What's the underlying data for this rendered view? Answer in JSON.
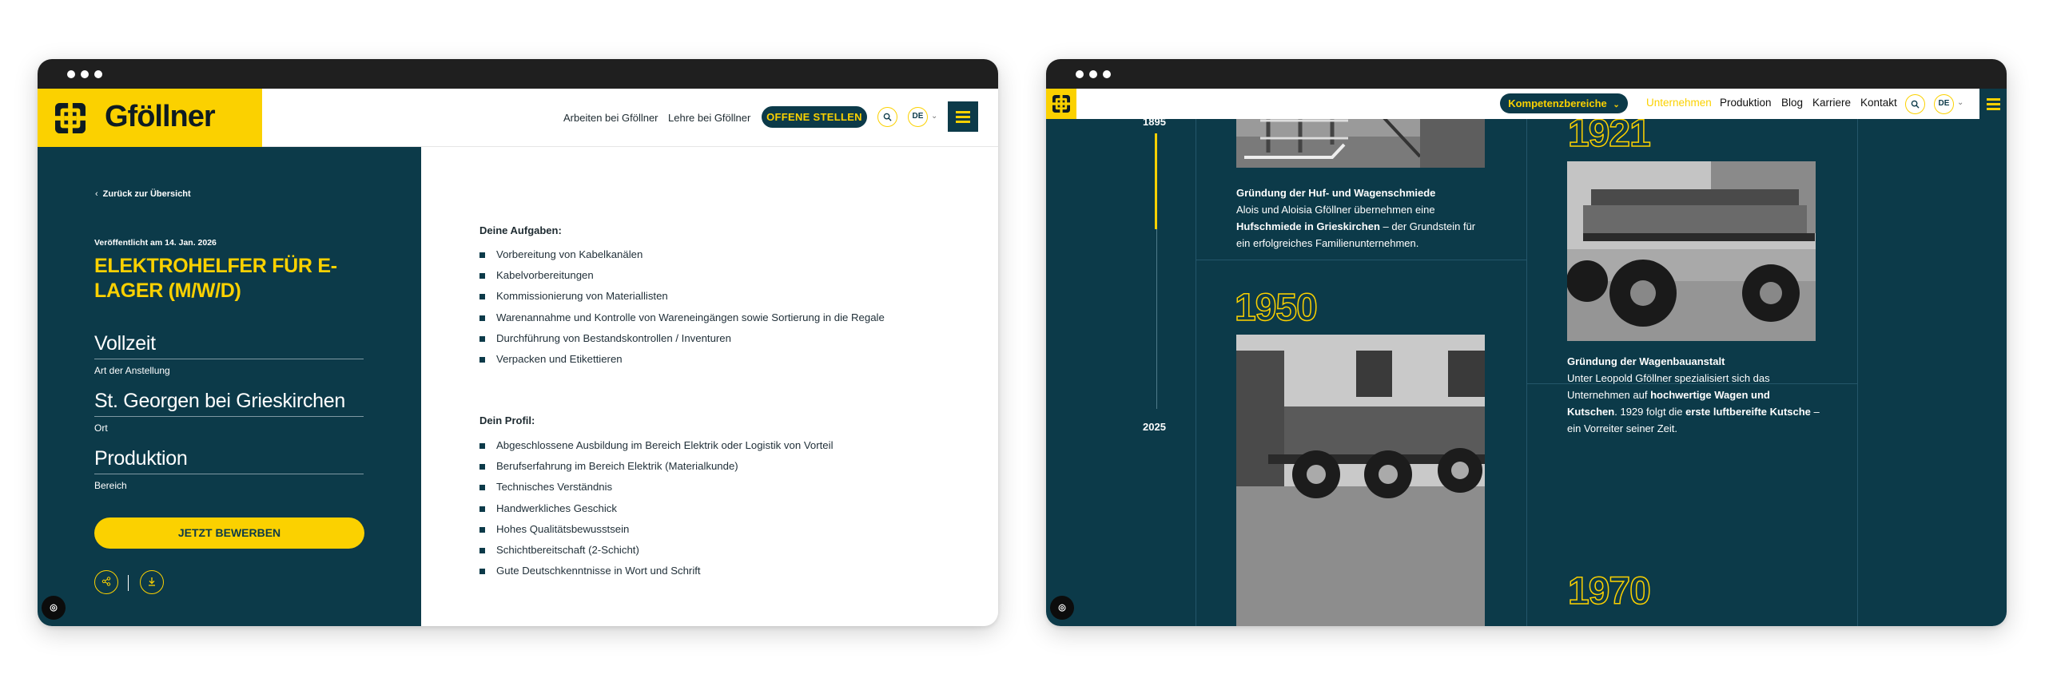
{
  "left_window": {
    "logo_text": "Gföllner",
    "nav": {
      "arbeiten": "Arbeiten bei Gföllner",
      "lehre": "Lehre bei Gföllner",
      "offene_stellen": "OFFENE STELLEN",
      "lang": "DE"
    },
    "sidebar": {
      "back_link": "Zurück zur Übersicht",
      "published": "Veröffentlicht am 14. Jan. 2026",
      "job_title": "ELEKTROHELFER FÜR E-LAGER (M/W/D)",
      "fields": [
        {
          "value": "Vollzeit",
          "label": "Art der Anstellung"
        },
        {
          "value": "St. Georgen bei Grieskirchen",
          "label": "Ort"
        },
        {
          "value": "Produktion",
          "label": "Bereich"
        }
      ],
      "apply_button": "JETZT BEWERBEN"
    },
    "main": {
      "tasks_heading": "Deine Aufgaben:",
      "tasks": [
        "Vorbereitung von Kabelkanälen",
        "Kabelvorbereitungen",
        "Kommissionierung von Materiallisten",
        "Warenannahme und Kontrolle von Wareneingängen sowie Sortierung in die Regale",
        "Durchführung von Bestandskontrollen / Inventuren",
        "Verpacken und Etikettieren"
      ],
      "profile_heading": "Dein Profil:",
      "profile": [
        "Abgeschlossene Ausbildung im Bereich Elektrik oder Logistik von Vorteil",
        "Berufserfahrung im Bereich Elektrik (Materialkunde)",
        "Technisches Verständnis",
        "Handwerkliches Geschick",
        "Hohes Qualitätsbewusstsein",
        "Schichtbereitschaft (2-Schicht)",
        "Gute Deutschkenntnisse in Wort und Schrift"
      ]
    }
  },
  "right_window": {
    "nav": {
      "kompetenz": "Kompetenzbereiche",
      "unternehmen": "Unternehmen",
      "produktion": "Produktion",
      "blog": "Blog",
      "karriere": "Karriere",
      "kontakt": "Kontakt",
      "lang": "DE"
    },
    "timeline": {
      "start_year": "1895",
      "end_year": "2025",
      "entries": {
        "e1895": {
          "title": "Gründung der Huf- und Wagenschmiede",
          "text_1": "Alois und Aloisia Gföllner übernehmen eine",
          "text_2_bold": "Hufschmiede in Grieskirchen",
          "text_2_rest": " – der Grundstein für",
          "text_3": "ein erfolgreiches Familienunternehmen."
        },
        "e1921": {
          "year": "1921",
          "title": "Gründung der Wagenbauanstalt",
          "text_1": "Unter Leopold Gföllner spezialisiert sich das",
          "text_2_pre": "Unternehmen auf ",
          "text_2_bold": "hochwertige Wagen und",
          "text_3_bold": "Kutschen",
          "text_3_mid": ". 1929 folgt die ",
          "text_3_bold2": "erste luftbereifte Kutsche",
          "text_3_rest": " –",
          "text_4": "ein Vorreiter seiner Zeit."
        },
        "e1950": {
          "year": "1950"
        },
        "e1970": {
          "year": "1970"
        }
      }
    }
  },
  "colors": {
    "brand_yellow": "#fbd100",
    "brand_petrol": "#0c3a49",
    "titlebar": "#1f1f1f"
  },
  "icons": [
    "logo-mark-icon",
    "search-icon",
    "chevron-down-icon",
    "hamburger-icon",
    "chevron-left-icon",
    "share-icon",
    "download-icon",
    "cookie-icon"
  ]
}
